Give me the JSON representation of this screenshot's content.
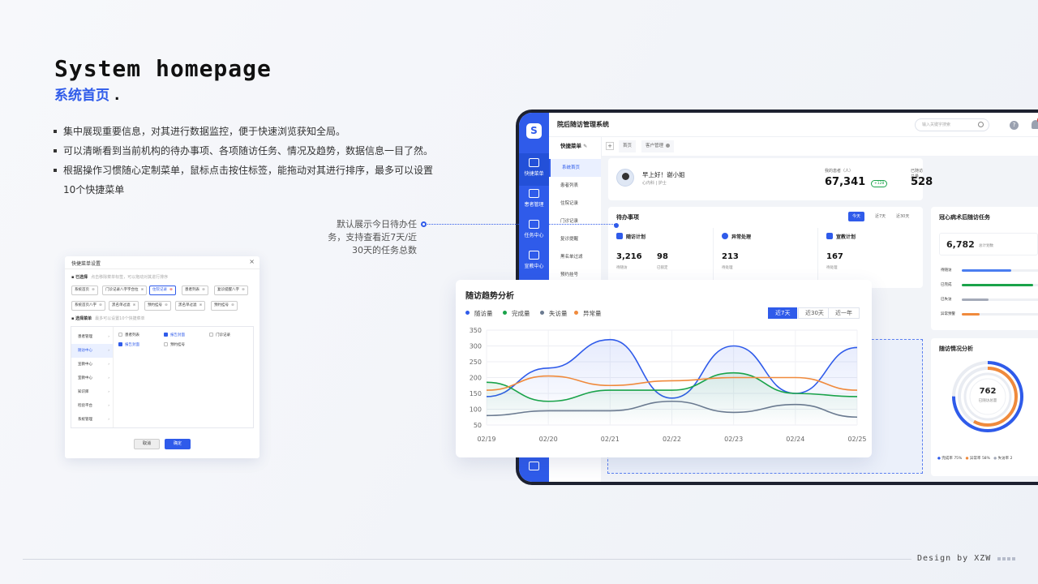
{
  "slide": {
    "title_en": "System homepage",
    "title_cn": "系统首页",
    "title_dot": ".",
    "bullets": [
      "集中展现重要信息，对其进行数据监控，便于快速浏览获知全局。",
      "可以清晰看到当前机构的待办事项、各项随访任务、情况及趋势，数据信息一目了然。",
      "根据操作习惯随心定制菜单，鼠标点击按住标签，能拖动对其进行排序，最多可以设置10个快捷菜单"
    ],
    "note": [
      "默认展示今日待办任",
      "务，支持查看近7天/近",
      "30天的任务总数"
    ],
    "footer": "Design by XZW"
  },
  "dialog": {
    "title": "快捷菜单设置",
    "close": "×",
    "selected_title": "已选择",
    "selected_hint": "点击移除菜单标签，可以拖动对其进行排序",
    "selected_chips": [
      {
        "label": "系统首页",
        "active": false
      },
      {
        "label": "门诊记录八字字合拉",
        "active": false
      },
      {
        "label": "住院记录",
        "active": true
      },
      {
        "label": "患者列表",
        "active": false
      },
      {
        "label": "复诊提醒八字",
        "active": false
      },
      {
        "label": "系统首页八字",
        "active": false
      },
      {
        "label": "黑名单过滤",
        "active": false
      },
      {
        "label": "预约挂号",
        "active": false
      },
      {
        "label": "黑名单过滤",
        "active": false
      },
      {
        "label": "预约挂号",
        "active": false
      }
    ],
    "choose_title": "选择菜单",
    "choose_hint": "最多可以设置10个快捷菜单",
    "categories": [
      {
        "label": "患者管理",
        "active": false
      },
      {
        "label": "随访中心",
        "active": true
      },
      {
        "label": "宣教中心",
        "active": false
      },
      {
        "label": "室教中心",
        "active": false
      },
      {
        "label": "知识库",
        "active": false
      },
      {
        "label": "检验平台",
        "active": false
      },
      {
        "label": "系统管理",
        "active": false
      }
    ],
    "options": [
      {
        "label": "患者列表",
        "checked": false
      },
      {
        "label": "报告封面",
        "checked": true
      },
      {
        "label": "门诊记录",
        "checked": false
      },
      {
        "label": "报告封面",
        "checked": true
      },
      {
        "label": "预约挂号",
        "checked": false
      }
    ],
    "cancel": "取消",
    "ok": "确定"
  },
  "app": {
    "logo": "S",
    "title": "院后随访管理系统",
    "search_placeholder": "输入关键字搜索",
    "help": "?",
    "notif_count": "5",
    "side_items": [
      "快捷菜单",
      "患者管理",
      "任务中心",
      "宣教中心"
    ],
    "quick_menu_label": "快捷菜单",
    "tabs": [
      "首页",
      "客户管理"
    ],
    "quick_items": [
      "系统首页",
      "患者列表",
      "住院记录",
      "门诊记录",
      "复诊提醒",
      "黑名单过滤",
      "预约挂号"
    ],
    "welcome": {
      "greeting": "早上好！谢小姐",
      "dept": "心内科 | 护士",
      "my_patients_label": "我的患者（人）",
      "my_patients": "67,341",
      "my_patients_badge": "+128",
      "followed_label": "已随访总量（人）",
      "followed": "528",
      "followed_badge": "+9"
    },
    "todo": {
      "title": "待办事项",
      "periods": [
        "今天",
        "近7天",
        "近30天"
      ],
      "cols": [
        {
          "title": "随访计划",
          "n1": "3,216",
          "l1": "待随访",
          "n2": "98",
          "l2": "已锁定"
        },
        {
          "title": "异常处理",
          "n1": "213",
          "l1": "待处理"
        },
        {
          "title": "宣教计划",
          "n1": "167",
          "l1": "待处理"
        }
      ]
    },
    "cad": {
      "title": "冠心病术后随访任务",
      "total": "6,782",
      "total_label": "总计划数",
      "rows": [
        {
          "label": "待随访",
          "value": 0.55,
          "color": "#4a7df0"
        },
        {
          "label": "已完成",
          "value": 0.8,
          "color": "#1aa34a"
        },
        {
          "label": "已失访",
          "value": 0.3,
          "color": "#a4aab8"
        },
        {
          "label": "异常预警",
          "value": 0.2,
          "color": "#f08a3c"
        }
      ]
    },
    "status": {
      "title": "随访情况分析",
      "center_value": "762",
      "center_label": "已随访总量",
      "legend": [
        {
          "label": "完成率",
          "value": "75%",
          "color": "#2f5bea"
        },
        {
          "label": "异常率",
          "value": "58%",
          "color": "#f08a3c"
        },
        {
          "label": "失访率",
          "value": "2",
          "color": "#a4aab8"
        }
      ]
    }
  },
  "trend": {
    "title": "随访趋势分析",
    "ranges": [
      "近7天",
      "近30天",
      "近一年"
    ],
    "active_range": 0
  },
  "chart_data": {
    "type": "line",
    "title": "随访趋势分析",
    "xlabel": "",
    "ylabel": "",
    "x": [
      "02/19",
      "02/20",
      "02/21",
      "02/22",
      "02/23",
      "02/24",
      "02/25"
    ],
    "y_ticks": [
      50,
      100,
      150,
      200,
      250,
      300,
      350
    ],
    "ylim": [
      50,
      350
    ],
    "grid": true,
    "legend_position": "top-left",
    "series": [
      {
        "name": "随访量",
        "color": "#2f5bea",
        "values": [
          140,
          230,
          320,
          135,
          300,
          150,
          295
        ]
      },
      {
        "name": "完成量",
        "color": "#1aa34a",
        "values": [
          185,
          125,
          160,
          160,
          215,
          150,
          140
        ]
      },
      {
        "name": "失访量",
        "color": "#6a7a90",
        "values": [
          80,
          95,
          95,
          125,
          90,
          115,
          75
        ]
      },
      {
        "name": "异常量",
        "color": "#f08a3c",
        "values": [
          160,
          205,
          175,
          190,
          200,
          200,
          160
        ]
      }
    ]
  }
}
